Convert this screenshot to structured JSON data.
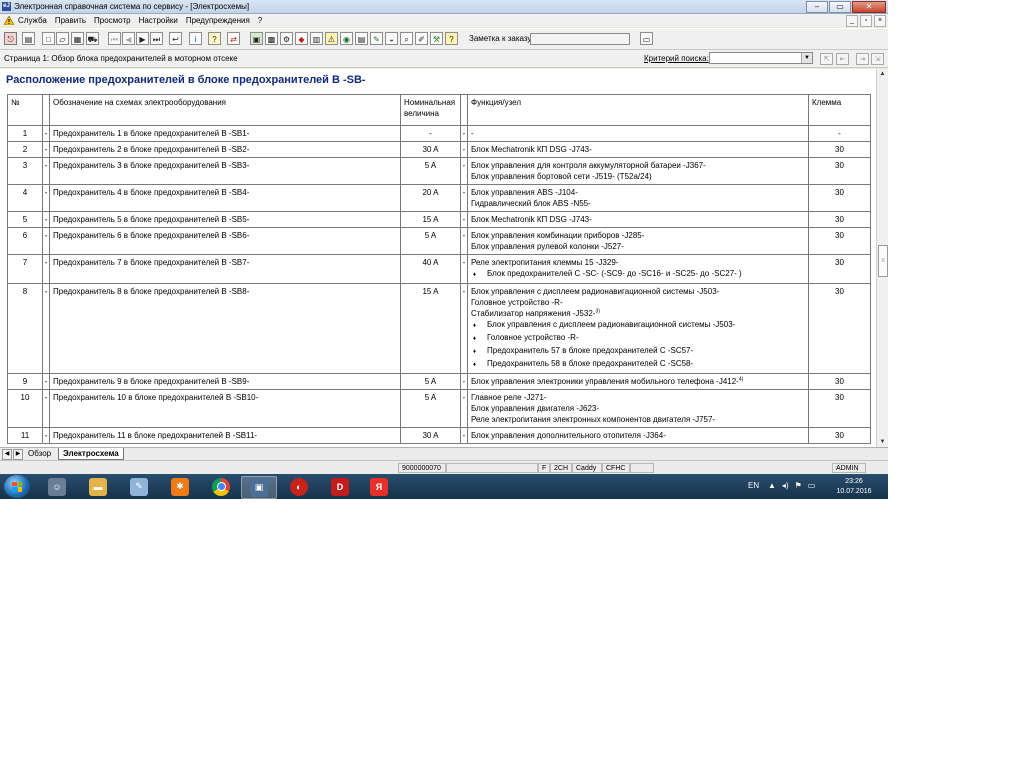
{
  "window": {
    "title": "Электронная справочная система по сервису - [Электросхемы]",
    "icon_text": "eJ"
  },
  "menu": {
    "items": [
      "Служба",
      "Править",
      "Просмотр",
      "Настройки",
      "Предупреждения",
      "?"
    ]
  },
  "toolbar": {
    "order_label": "Заметка к заказу:",
    "order_value": ""
  },
  "pagebar": {
    "page_label": "Страница 1: Обзор блока предохранителей в моторном отсеке",
    "search_label": "Критерий поиска:",
    "search_value": ""
  },
  "document": {
    "title": "Расположение предохранителей в блоке предохранителей В -SB-",
    "headers": {
      "num": "№",
      "designation": "Обозначение на схемах электрооборудования",
      "nominal": "Номинальная величина",
      "function": "Функция/узел",
      "terminal": "Клемма"
    },
    "rows": [
      {
        "num": "1",
        "dash": "-",
        "designation": "Предохранитель 1 в блоке предохранителей В -SB1-",
        "nominal": "-",
        "dash2": "-",
        "functions": [
          "-"
        ],
        "bullets": [],
        "terminal": "-"
      },
      {
        "num": "2",
        "dash": "-",
        "designation": "Предохранитель 2 в блоке предохранителей В -SB2-",
        "nominal": "30 A",
        "dash2": "-",
        "functions": [
          "Блок Mechatronik КП DSG -J743-"
        ],
        "bullets": [],
        "terminal": "30"
      },
      {
        "num": "3",
        "dash": "-",
        "designation": "Предохранитель 3 в блоке предохранителей В -SB3-",
        "nominal": "5 A",
        "dash2": "-",
        "functions": [
          "Блок управления для контроля аккумуляторной батареи -J367-",
          "Блок управления бортовой сети -J519- (T52a/24)"
        ],
        "bullets": [],
        "terminal": "30"
      },
      {
        "num": "4",
        "dash": "-",
        "designation": "Предохранитель 4 в блоке предохранителей В -SB4-",
        "nominal": "20 A",
        "dash2": "-",
        "functions": [
          "Блок управления ABS -J104-",
          "Гидравлический блок ABS -N55-"
        ],
        "bullets": [],
        "terminal": "30"
      },
      {
        "num": "5",
        "dash": "-",
        "designation": "Предохранитель 5 в блоке предохранителей В -SB5-",
        "nominal": "15 A",
        "dash2": "-",
        "functions": [
          "Блок Mechatronik КП DSG -J743-"
        ],
        "bullets": [],
        "terminal": "30"
      },
      {
        "num": "6",
        "dash": "-",
        "designation": "Предохранитель 6 в блоке предохранителей В -SB6-",
        "nominal": "5 A",
        "dash2": "-",
        "functions": [
          "Блок управления комбинации приборов -J285-",
          "Блок управления рулевой колонки -J527-"
        ],
        "bullets": [],
        "terminal": "30"
      },
      {
        "num": "7",
        "dash": "-",
        "designation": "Предохранитель 7 в блоке предохранителей В -SB7-",
        "nominal": "40 A",
        "dash2": "-",
        "functions": [
          "Реле электропитания клеммы 15 -J329-"
        ],
        "bullets": [
          "Блок предохранителей C -SC- (-SC9- до -SC16- и -SC25- до -SC27- )"
        ],
        "terminal": "30"
      },
      {
        "num": "8",
        "dash": "-",
        "designation": "Предохранитель 8 в блоке предохранителей В -SB8-",
        "nominal": "15 A",
        "dash2": "-",
        "functions": [
          "Блок управления с дисплеем радионавигационной системы -J503-",
          "Головное устройство -R-",
          "Стабилизатор напряжения -J532-"
        ],
        "fn_sup": {
          "index": 2,
          "mark": "3)"
        },
        "bullets": [
          "Блок управления с дисплеем радионавигационной системы -J503-",
          "Головное устройство -R-",
          "Предохранитель 57 в блоке предохранителей C -SC57-",
          "Предохранитель 58 в блоке предохранителей C -SC58-"
        ],
        "terminal": "30"
      },
      {
        "num": "9",
        "dash": "-",
        "designation": "Предохранитель 9 в блоке предохранителей В -SB9-",
        "nominal": "5 A",
        "dash2": "-",
        "functions": [
          "Блок управления электроники управления мобильного телефона -J412-"
        ],
        "fn_sup": {
          "index": 0,
          "mark": "4)"
        },
        "bullets": [],
        "terminal": "30"
      },
      {
        "num": "10",
        "dash": "-",
        "designation": "Предохранитель 10 в блоке предохранителей В -SB10-",
        "nominal": "5 A",
        "dash2": "-",
        "functions": [
          "Главное реле -J271-",
          "Блок управления двигателя -J623-",
          "Реле электропитания электронных компонентов двигателя -J757-"
        ],
        "bullets": [],
        "terminal": "30"
      },
      {
        "num": "11",
        "dash": "-",
        "designation": "Предохранитель 11 в блоке предохранителей В -SB11-",
        "nominal": "30 A",
        "dash2": "-",
        "functions": [
          "Блок управления дополнительного отопителя -J364-"
        ],
        "bullets": [],
        "terminal": "30"
      }
    ]
  },
  "sheet_tabs": [
    "Обзор",
    "Электросхема"
  ],
  "status": {
    "code": "9000000070",
    "f": "F",
    "ch": "2CH",
    "caddy": "Caddy",
    "cfhc": "CFHC",
    "user": "ADMIN"
  },
  "taskbar": {
    "lang": "EN",
    "time": "23:26",
    "date": "10.07.2016"
  }
}
